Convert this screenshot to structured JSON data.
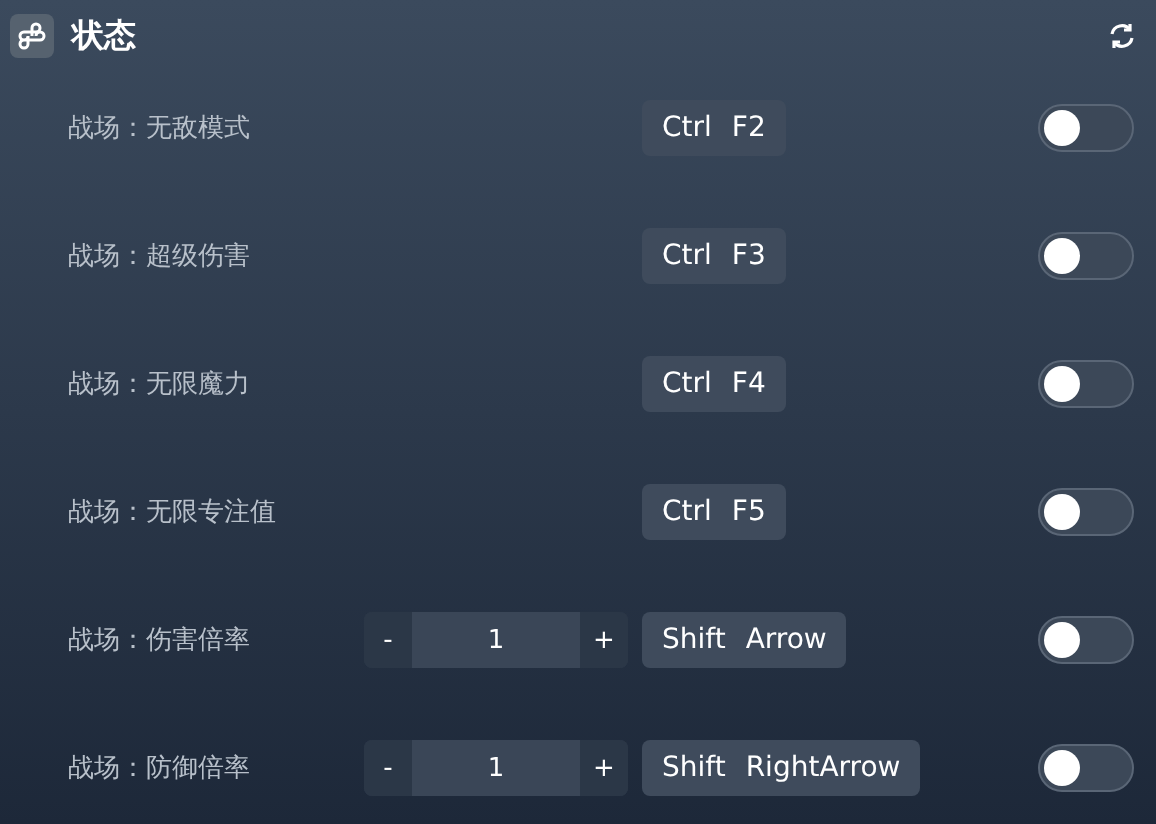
{
  "header": {
    "title": "状态"
  },
  "rows": [
    {
      "label": "战场：无敌模式",
      "kind": "toggle",
      "keys": [
        "Ctrl",
        "F2"
      ],
      "on": false
    },
    {
      "label": "战场：超级伤害",
      "kind": "toggle",
      "keys": [
        "Ctrl",
        "F3"
      ],
      "on": false
    },
    {
      "label": "战场：无限魔力",
      "kind": "toggle",
      "keys": [
        "Ctrl",
        "F4"
      ],
      "on": false
    },
    {
      "label": "战场：无限专注值",
      "kind": "toggle",
      "keys": [
        "Ctrl",
        "F5"
      ],
      "on": false
    },
    {
      "label": "战场：伤害倍率",
      "kind": "stepper",
      "minus": "-",
      "value": "1",
      "plus": "+",
      "keys": [
        "Shift",
        "Arrow"
      ],
      "on": false
    },
    {
      "label": "战场：防御倍率",
      "kind": "stepper",
      "minus": "-",
      "value": "1",
      "plus": "+",
      "keys": [
        "Shift",
        "RightArrow"
      ],
      "on": false
    }
  ]
}
